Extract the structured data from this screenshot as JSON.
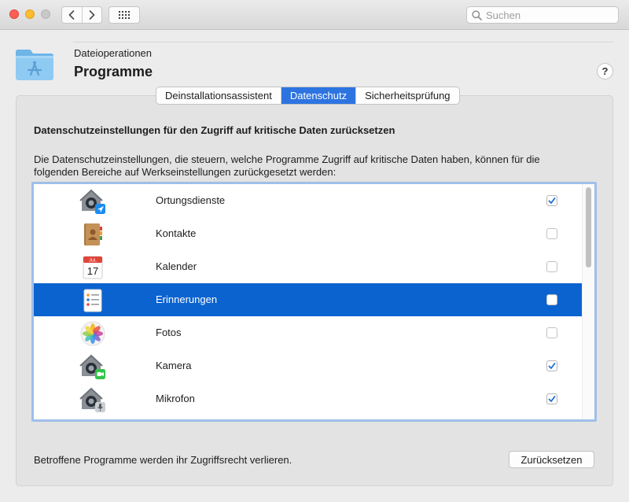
{
  "toolbar": {
    "search_placeholder": "Suchen",
    "back_icon": "chevron-left-icon",
    "forward_icon": "chevron-right-icon",
    "grid_icon": "show-all-grid-icon"
  },
  "header": {
    "breadcrumb": "Dateioperationen",
    "title": "Programme",
    "help_label": "?"
  },
  "tabs": [
    {
      "label": "Deinstallationsassistent",
      "active": false
    },
    {
      "label": "Datenschutz",
      "active": true
    },
    {
      "label": "Sicherheitsprüfung",
      "active": false
    }
  ],
  "privacy": {
    "heading": "Datenschutzeinstellungen für den Zugriff auf kritische Daten zurücksetzen",
    "description": "Die Datenschutzeinstellungen, die steuern, welche Programme Zugriff auf kritische Daten haben, können für die folgenden Bereiche auf Werkseinstellungen zurückgesetzt werden:",
    "items": [
      {
        "label": "Ortungsdienste",
        "icon": "location-services-icon",
        "checked": true,
        "selected": false
      },
      {
        "label": "Kontakte",
        "icon": "contacts-book-icon",
        "checked": false,
        "selected": false
      },
      {
        "label": "Kalender",
        "icon": "calendar-icon",
        "checked": false,
        "selected": false
      },
      {
        "label": "Erinnerungen",
        "icon": "reminders-icon",
        "checked": false,
        "selected": true
      },
      {
        "label": "Fotos",
        "icon": "photos-icon",
        "checked": false,
        "selected": false
      },
      {
        "label": "Kamera",
        "icon": "camera-icon",
        "checked": true,
        "selected": false
      },
      {
        "label": "Mikrofon",
        "icon": "microphone-icon",
        "checked": true,
        "selected": false
      }
    ],
    "calendar_month": "JUL",
    "calendar_day": "17"
  },
  "footer": {
    "note": "Betroffene Programme werden ihr Zugriffsrecht verlieren.",
    "reset_label": "Zurücksetzen"
  },
  "colors": {
    "accent": "#2d74e0",
    "selection": "#0b63cf",
    "checkbox_check": "#1f6fd6"
  }
}
